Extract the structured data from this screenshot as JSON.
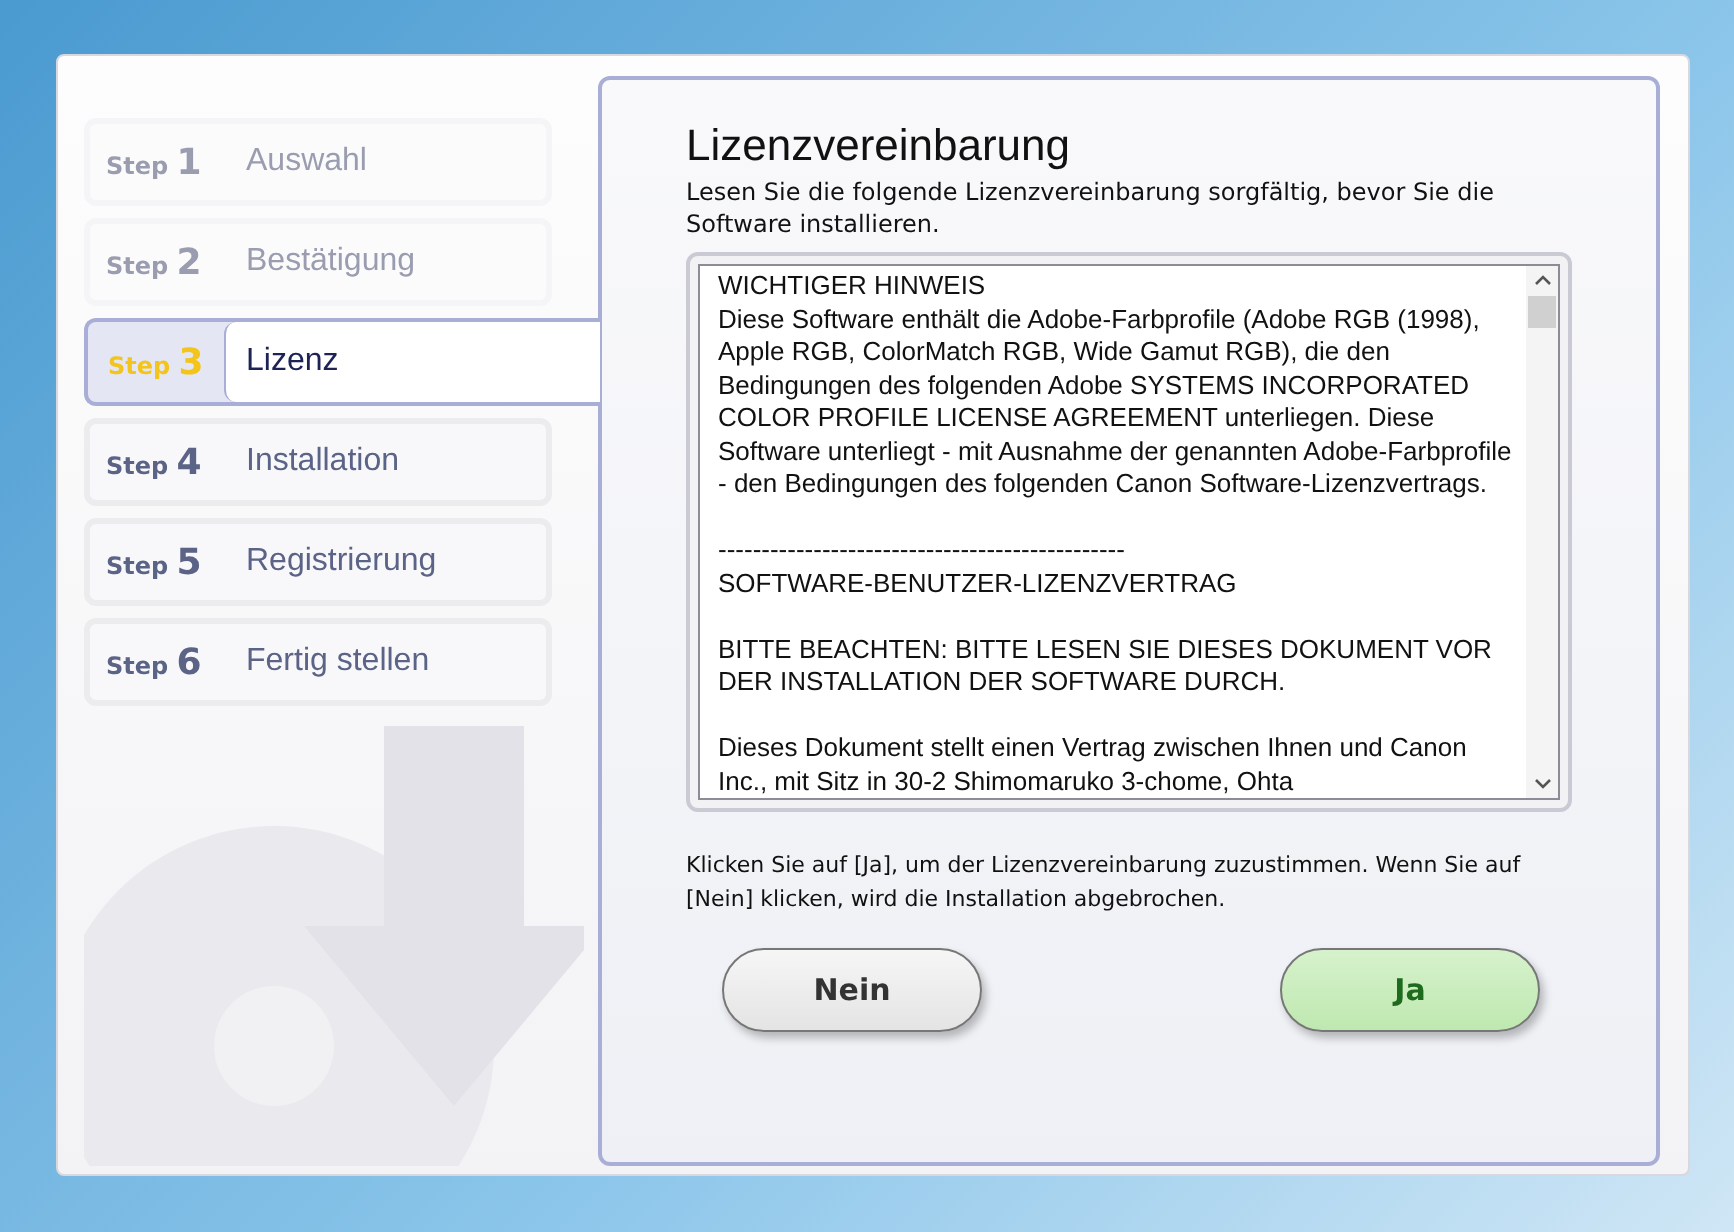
{
  "steps": [
    {
      "prefix": "Step",
      "number": "1",
      "label": "Auswahl",
      "selected": false,
      "disabled": true
    },
    {
      "prefix": "Step",
      "number": "2",
      "label": "Bestätigung",
      "selected": false,
      "disabled": true
    },
    {
      "prefix": "Step",
      "number": "3",
      "label": "Lizenz",
      "selected": true,
      "disabled": false
    },
    {
      "prefix": "Step",
      "number": "4",
      "label": "Installation",
      "selected": false,
      "disabled": false
    },
    {
      "prefix": "Step",
      "number": "5",
      "label": "Registrierung",
      "selected": false,
      "disabled": false
    },
    {
      "prefix": "Step",
      "number": "6",
      "label": "Fertig stellen",
      "selected": false,
      "disabled": false
    }
  ],
  "title": "Lizenzvereinbarung",
  "intro": "Lesen Sie die folgende Lizenzvereinbarung sorgfältig, bevor Sie die Software installieren.",
  "license_sections": [
    [
      "WICHTIGER HINWEIS",
      "Diese Software enthält die Adobe-Farbprofile (Adobe RGB (1998), Apple RGB, ColorMatch RGB, Wide Gamut RGB), die den Bedingungen des folgenden Adobe SYSTEMS INCORPORATED COLOR PROFILE LICENSE AGREEMENT unterliegen. Diese Software unterliegt - mit Ausnahme der genannten Adobe-Farbprofile - den Bedingungen des folgenden Canon Software-Lizenzvertrags."
    ],
    [
      "-----------------------------------------------",
      "SOFTWARE-BENUTZER-LIZENZVERTRAG"
    ],
    [
      "BITTE BEACHTEN: BITTE LESEN SIE DIESES DOKUMENT VOR DER INSTALLATION DER SOFTWARE DURCH."
    ],
    [
      "Dieses Dokument stellt einen Vertrag zwischen Ihnen und Canon Inc., mit Sitz in 30-2 Shimomaruko 3-chome, Ohta"
    ]
  ],
  "instruction": "Klicken Sie auf [Ja], um der Lizenzvereinbarung zuzustimmen. Wenn Sie auf [Nein] klicken, wird die Installation abgebrochen.",
  "buttons": [
    {
      "label": "Nein",
      "kind": "decline"
    },
    {
      "label": "Ja",
      "kind": "accept"
    }
  ]
}
